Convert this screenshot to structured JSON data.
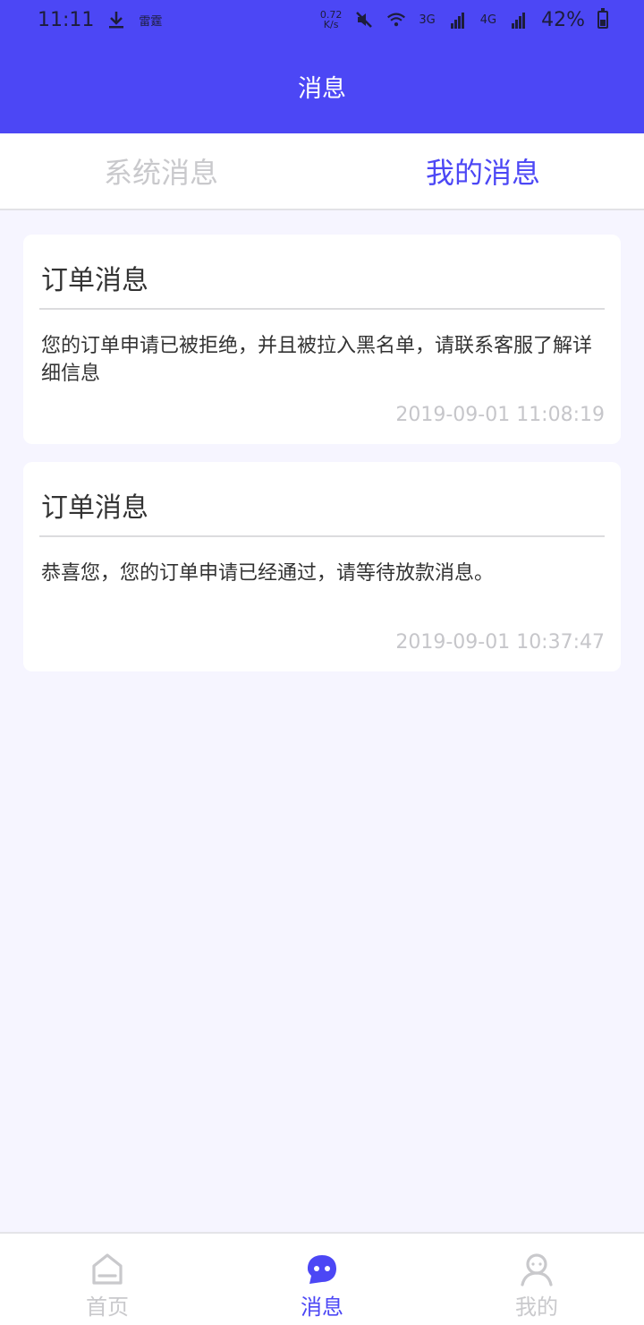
{
  "status_bar": {
    "time": "11:11",
    "carrier_note": "雷霆",
    "net_speed": "0.72",
    "net_unit": "K/s",
    "sig_3g": "3G",
    "sig_4g": "4G",
    "battery": "42%",
    "battery_fill_fraction": 0.42
  },
  "header": {
    "title": "消息"
  },
  "tabs": [
    {
      "label": "系统消息",
      "active": false
    },
    {
      "label": "我的消息",
      "active": true
    }
  ],
  "messages": [
    {
      "title": "订单消息",
      "body": "您的订单申请已被拒绝，并且被拉入黑名单，请联系客服了解详细信息",
      "time": "2019-09-01 11:08:19"
    },
    {
      "title": "订单消息",
      "body": "恭喜您，您的订单申请已经通过，请等待放款消息。",
      "time": "2019-09-01 10:37:47"
    }
  ],
  "bottom_nav": [
    {
      "label": "首页",
      "icon": "home-icon",
      "active": false
    },
    {
      "label": "消息",
      "icon": "chat-icon",
      "active": true
    },
    {
      "label": "我的",
      "icon": "profile-icon",
      "active": false
    }
  ],
  "colors": {
    "accent": "#4c47f5",
    "inactive": "#c9c9cc",
    "background": "#f6f5ff"
  }
}
